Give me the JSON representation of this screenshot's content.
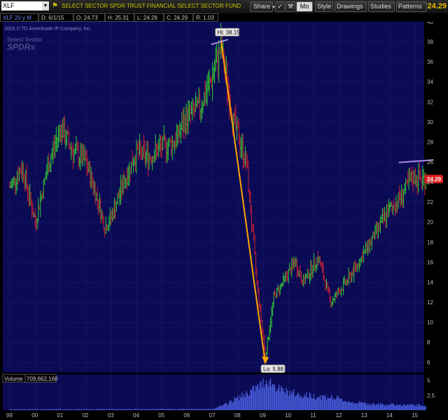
{
  "toolbar": {
    "symbol": "XLF",
    "description": "SELECT SECTOR SPDR TRUST FINANCIAL SELECT SECTOR FUND",
    "share": "Share",
    "mo": "Mo",
    "style": "Style",
    "drawings": "Drawings",
    "studies": "Studies",
    "patterns": "Patterns",
    "price": "24.29"
  },
  "infobar": {
    "period": "XLF 20 y M",
    "date": "D: 6/1/15",
    "open": "O: 24.73",
    "high": "H: 25.31",
    "low": "L: 24.28",
    "close": "C: 24.29",
    "range": "R: 1.03"
  },
  "watermark": {
    "copyright": "2015 © TD Ameritrade IP Company, Inc.",
    "line1": "Select Sector",
    "line2": "SPDRs"
  },
  "colors": {
    "background": "#0a0a55",
    "grid": "#2a2a7a",
    "up": "#33cc33",
    "down": "#cc2233",
    "trend": "#ffa500",
    "hline": "#b088e8",
    "last": "#e02020"
  },
  "annotations": {
    "hi": "Hi: 38.15",
    "lo": "Lo: 5.88",
    "last": "24.29"
  },
  "volume": {
    "label": "Volume",
    "value": "709,662,160",
    "ticks": [
      "5",
      "2.5"
    ]
  },
  "chart_data": {
    "type": "ohlc",
    "symbol": "XLF",
    "interval": "monthly",
    "ylim": [
      5,
      40
    ],
    "yticks": [
      "6",
      "8",
      "10",
      "12",
      "14",
      "16",
      "18",
      "20",
      "22",
      "24",
      "26",
      "28",
      "30",
      "32",
      "34",
      "36",
      "38",
      "40"
    ],
    "xticks": [
      "99",
      "00",
      "01",
      "02",
      "03",
      "04",
      "05",
      "06",
      "07",
      "08",
      "09",
      "10",
      "11",
      "12",
      "13",
      "14",
      "15"
    ],
    "trend_line": {
      "from": {
        "date": "2007-05",
        "price": 38.15
      },
      "to": {
        "date": "2009-02",
        "price": 5.88
      }
    },
    "high": 38.15,
    "low": 5.88,
    "last": 24.29,
    "price_path": [
      [
        "1999-01",
        23.5
      ],
      [
        "1999-07",
        25.5
      ],
      [
        "2000-01",
        20.0
      ],
      [
        "2000-07",
        25.5
      ],
      [
        "2001-01",
        29.5
      ],
      [
        "2001-07",
        27.0
      ],
      [
        "2002-01",
        26.0
      ],
      [
        "2002-07",
        22.0
      ],
      [
        "2002-10",
        19.5
      ],
      [
        "2003-01",
        20.5
      ],
      [
        "2003-07",
        24.0
      ],
      [
        "2004-01",
        27.0
      ],
      [
        "2004-07",
        26.5
      ],
      [
        "2005-01",
        27.5
      ],
      [
        "2005-07",
        28.0
      ],
      [
        "2006-01",
        30.5
      ],
      [
        "2006-07",
        31.5
      ],
      [
        "2007-01",
        34.5
      ],
      [
        "2007-05",
        37.5
      ],
      [
        "2007-11",
        30.0
      ],
      [
        "2008-05",
        26.0
      ],
      [
        "2008-10",
        14.0
      ],
      [
        "2009-02",
        6.5
      ],
      [
        "2009-06",
        12.5
      ],
      [
        "2010-04",
        16.0
      ],
      [
        "2010-08",
        14.0
      ],
      [
        "2011-03",
        16.5
      ],
      [
        "2011-09",
        12.0
      ],
      [
        "2012-06",
        14.5
      ],
      [
        "2013-01",
        17.0
      ],
      [
        "2013-12",
        21.0
      ],
      [
        "2014-06",
        22.5
      ],
      [
        "2014-12",
        24.5
      ],
      [
        "2015-06",
        24.29
      ]
    ],
    "volume_path": [
      [
        "1999-01",
        0.15
      ],
      [
        "2007-01",
        0.2
      ],
      [
        "2007-06",
        0.8
      ],
      [
        "2008-06",
        3.0
      ],
      [
        "2008-12",
        4.2
      ],
      [
        "2009-03",
        5.2
      ],
      [
        "2009-09",
        3.4
      ],
      [
        "2010-06",
        2.6
      ],
      [
        "2011-09",
        2.2
      ],
      [
        "2012-06",
        1.4
      ],
      [
        "2013-06",
        1.0
      ],
      [
        "2014-06",
        0.9
      ],
      [
        "2015-06",
        0.8
      ]
    ]
  }
}
